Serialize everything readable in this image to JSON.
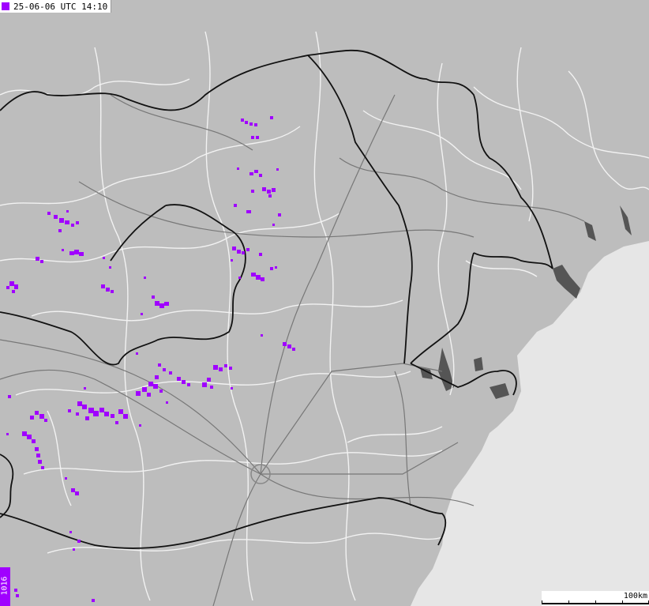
{
  "header": {
    "timestamp": "25-06-06 UTC 14:10",
    "legend_color": "#a000ff"
  },
  "strike_counter": {
    "value": "1016"
  },
  "scale_bar": {
    "label": "100km"
  },
  "colors": {
    "land": "#bdbdbd",
    "sea": "#e6e6e6",
    "water": "#555555",
    "border": "#111111",
    "region_lines": "#f2f2f2",
    "roads": "#777777",
    "lightning": "#a000ff"
  }
}
